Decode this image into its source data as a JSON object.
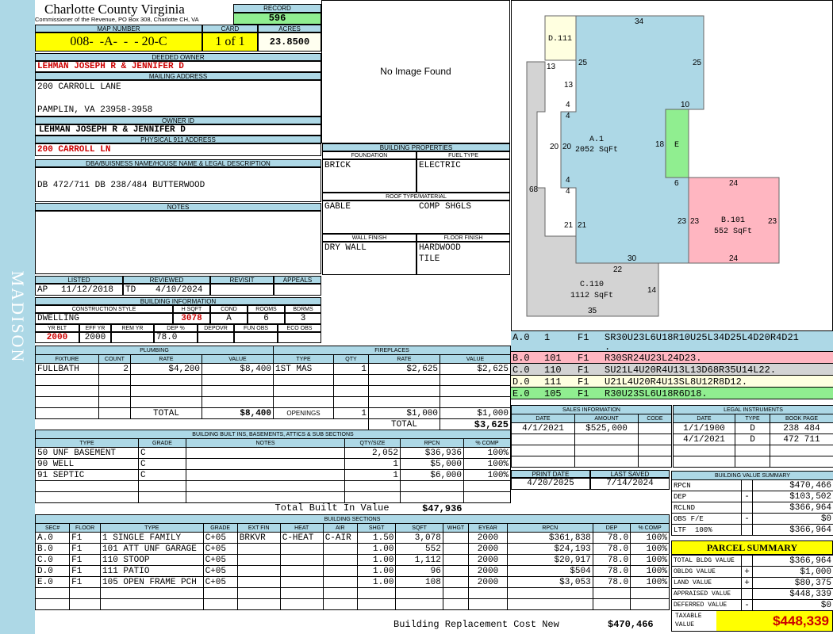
{
  "sidebar": {
    "district": "MADISON"
  },
  "header": {
    "county": "Charlotte County Virginia",
    "commissioner": "Commissioner of the Revenue, PO Box 308, Charlotte CH, VA",
    "record_label": "RECORD",
    "record": "596",
    "map_number_label": "MAP NUMBER",
    "map_number": "008-  -A-  -  - 20-C",
    "card_label": "CARD",
    "card": "1 of 1",
    "acres_label": "ACRES",
    "acres": "23.8500"
  },
  "owner": {
    "deeded_label": "DEEDED OWNER",
    "deeded": "LEHMAN JOSEPH R & JENNIFER D",
    "mailing_label": "MAILING ADDRESS",
    "mailing_line1": "200 CARROLL LANE",
    "mailing_line2": "PAMPLIN, VA 23958-3958",
    "owner_id_label": "OWNER ID",
    "owner_id": "LEHMAN JOSEPH R & JENNIFER D",
    "physical_label": "PHYSICAL 911 ADDRESS",
    "physical": "200 CARROLL LN",
    "legal_label": "DBA/BUISNESS NAME/HOUSE NAME & LEGAL DESCRIPTION",
    "legal": "DB 472/711 DB 238/484 BUTTERWOOD",
    "notes_label": "NOTES"
  },
  "image": {
    "placeholder": "No Image Found"
  },
  "building_properties": {
    "title": "BUILDING PROPERTIES",
    "foundation_label": "FOUNDATION",
    "foundation": "BRICK",
    "fuel_label": "FUEL TYPE",
    "fuel": "ELECTRIC",
    "roof_label": "ROOF TYPE/MATERIAL",
    "roof_type": "GABLE",
    "roof_material": "COMP SHGLS",
    "wall_label": "WALL FINISH",
    "wall": "DRY WALL",
    "floor_label": "FLOOR FINISH",
    "floor1": "HARDWOOD",
    "floor2": "TILE"
  },
  "status": {
    "listed_label": "LISTED",
    "listed_code": "AP",
    "listed_date": "11/12/2018",
    "reviewed_label": "REVIEWED",
    "reviewed_code": "TD",
    "reviewed_date": "4/10/2024",
    "revisit_label": "REVISIT",
    "appeals_label": "APPEALS"
  },
  "building_info": {
    "title": "BUILDING INFORMATION",
    "style_label": "CONSTRUCTION STYLE",
    "style": "DWELLING",
    "hsqft_label": "H SQFT",
    "hsqft": "3078",
    "cond_label": "COND",
    "cond": "A",
    "rooms_label": "ROOMS",
    "rooms": "6",
    "bdrms_label": "BDRMS",
    "bdrms": "3",
    "yrblt_label": "YR BLT",
    "yrblt": "2000",
    "effyr_label": "EFF YR",
    "effyr": "2000",
    "remyr_label": "REM YR",
    "remyr": "",
    "dep_label": "DEP %",
    "dep": "78.0",
    "depovr_label": "DEPOVR",
    "funobs_label": "FUN OBS",
    "ecoobs_label": "ECO OBS"
  },
  "plumbing": {
    "title": "PLUMBING",
    "headers": [
      "FIXTURE",
      "COUNT",
      "RATE",
      "VALUE"
    ],
    "rows": [
      [
        "FULLBATH",
        "2",
        "$4,200",
        "$8,400"
      ]
    ],
    "total_label": "TOTAL",
    "total": "$8,400"
  },
  "fireplaces": {
    "title": "FIREPLACES",
    "headers": [
      "TYPE",
      "QTY",
      "RATE",
      "VALUE"
    ],
    "rows": [
      [
        "1ST MAS",
        "1",
        "$2,625",
        "$2,625"
      ]
    ],
    "openings_label": "OPENINGS",
    "openings": [
      "1",
      "$1,000",
      "$1,000"
    ],
    "total_label": "TOTAL",
    "total": "$3,625"
  },
  "built_ins": {
    "title": "BUILDING BUILT INS, BASEMENTS, ATTICS & SUB SECTIONS",
    "headers": [
      "TYPE",
      "GRADE",
      "NOTES",
      "QTY/SIZE",
      "RPCN",
      "% COMP"
    ],
    "rows": [
      [
        "50 UNF BASEMENT",
        "C",
        "",
        "2,052",
        "$36,936",
        "100%"
      ],
      [
        "90 WELL",
        "C",
        "",
        "1",
        "$5,000",
        "100%"
      ],
      [
        "91 SEPTIC",
        "C",
        "",
        "1",
        "$6,000",
        "100%"
      ]
    ],
    "total_label": "Total Built In Value",
    "total": "$47,936"
  },
  "sections": {
    "title": "BUILDING SECTIONS",
    "headers": [
      "SEC#",
      "FLOOR",
      "TYPE",
      "GRADE",
      "EXT FIN",
      "HEAT",
      "AIR",
      "SHGT",
      "SQFT",
      "WHGT",
      "EYEAR",
      "RPCN",
      "DEP",
      "% COMP"
    ],
    "rows": [
      [
        "A.0",
        "F1",
        "1 SINGLE FAMILY",
        "C+05",
        "BRKVR",
        "C-HEAT",
        "C-AIR",
        "1.50",
        "3,078",
        "",
        "2000",
        "$361,838",
        "78.0",
        "100%"
      ],
      [
        "B.0",
        "F1",
        "101 ATT UNF GARAGE",
        "C+05",
        "",
        "",
        "",
        "1.00",
        "552",
        "",
        "2000",
        "$24,193",
        "78.0",
        "100%"
      ],
      [
        "C.0",
        "F1",
        "110 STOOP",
        "C+05",
        "",
        "",
        "",
        "1.00",
        "1,112",
        "",
        "2000",
        "$20,917",
        "78.0",
        "100%"
      ],
      [
        "D.0",
        "F1",
        "111 PATIO",
        "C+05",
        "",
        "",
        "",
        "1.00",
        "96",
        "",
        "2000",
        "$504",
        "78.0",
        "100%"
      ],
      [
        "E.0",
        "F1",
        "105 OPEN FRAME PCH",
        "C+05",
        "",
        "",
        "",
        "1.00",
        "108",
        "",
        "2000",
        "$3,053",
        "78.0",
        "100%"
      ]
    ],
    "replacement_label": "Building Replacement Cost New",
    "replacement": "$470,466"
  },
  "sketch": {
    "labels": {
      "d111": "D.111",
      "a1": "A.1",
      "a1_area": "2052 SqFt",
      "e": "E",
      "b101": "B.101",
      "b101_area": "552 SqFt",
      "c110": "C.110",
      "c110_area": "1112 SqFt"
    },
    "dims": {
      "d34": "34",
      "d13a": "13",
      "d25a": "25",
      "d25b": "25",
      "d13b": "13",
      "d4a": "4",
      "d10": "10",
      "d4b": "4",
      "d20a": "20",
      "d20b": "20",
      "d18": "18",
      "d68": "68",
      "d4c": "4",
      "d4d": "4",
      "d6": "6",
      "d24a": "24",
      "d23a": "23",
      "d23b": "23",
      "d23c": "23",
      "d21a": "21",
      "d21b": "21",
      "d30": "30",
      "d24b": "24",
      "d22": "22",
      "d14": "14",
      "d35": "35"
    }
  },
  "vectors": [
    {
      "sec": "A.0",
      "num": "1",
      "floor": "F1",
      "vector": "SR30U23L6U18R10U25L34D25L4D20R4D21",
      "cont": ".",
      "color": "#add8e6"
    },
    {
      "sec": "B.0",
      "num": "101",
      "floor": "F1",
      "vector": "R30SR24U23L24D23.",
      "color": "#ffb6c1"
    },
    {
      "sec": "C.0",
      "num": "110",
      "floor": "F1",
      "vector": "SU21L4U20R4U13L13D68R35U14L22.",
      "color": "#d3d3d3"
    },
    {
      "sec": "D.0",
      "num": "111",
      "floor": "F1",
      "vector": "U21L4U20R4U13SL8U12R8D12.",
      "color": "#ffffe0"
    },
    {
      "sec": "E.0",
      "num": "105",
      "floor": "F1",
      "vector": "R30U23SL6U18R6D18.",
      "color": "#90ee90"
    }
  ],
  "sales": {
    "title": "SALES INFORMATION",
    "headers": [
      "DATE",
      "AMOUNT",
      "CODE"
    ],
    "rows": [
      [
        "4/1/2021",
        "$525,000",
        ""
      ]
    ]
  },
  "legal_instruments": {
    "title": "LEGAL INSTRUMENTS",
    "headers": [
      "DATE",
      "TYPE",
      "BOOK PAGE"
    ],
    "rows": [
      [
        "1/1/1900",
        "D",
        "238 484"
      ],
      [
        "4/1/2021",
        "D",
        "472 711"
      ]
    ]
  },
  "dates": {
    "print_label": "PRINT DATE",
    "print": "4/20/2025",
    "saved_label": "LAST SAVED",
    "saved": "7/14/2024"
  },
  "value_summary": {
    "title": "BUILDING VALUE SUMMARY",
    "rows": [
      [
        "RPCN",
        "",
        "$470,466"
      ],
      [
        "DEP",
        "-",
        "$103,502"
      ],
      [
        "RCLND",
        "",
        "$366,964"
      ],
      [
        "OBS F/E",
        "-",
        "$0"
      ],
      [
        "LTF  100%",
        "",
        "$366,964"
      ]
    ]
  },
  "parcel_summary": {
    "title": "PARCEL SUMMARY",
    "rows": [
      [
        "TOTAL BLDG VALUE",
        "",
        "$366,964"
      ],
      [
        "OBLDG VALUE",
        "+",
        "$1,000"
      ],
      [
        "LAND VALUE",
        "+",
        "$80,375"
      ],
      [
        "APPRAISED VALUE",
        "",
        "$448,339"
      ],
      [
        "DEFERRED VALUE",
        "-",
        "$0"
      ]
    ],
    "taxable_label": "TAXABLE VALUE",
    "taxable": "$448,339"
  }
}
